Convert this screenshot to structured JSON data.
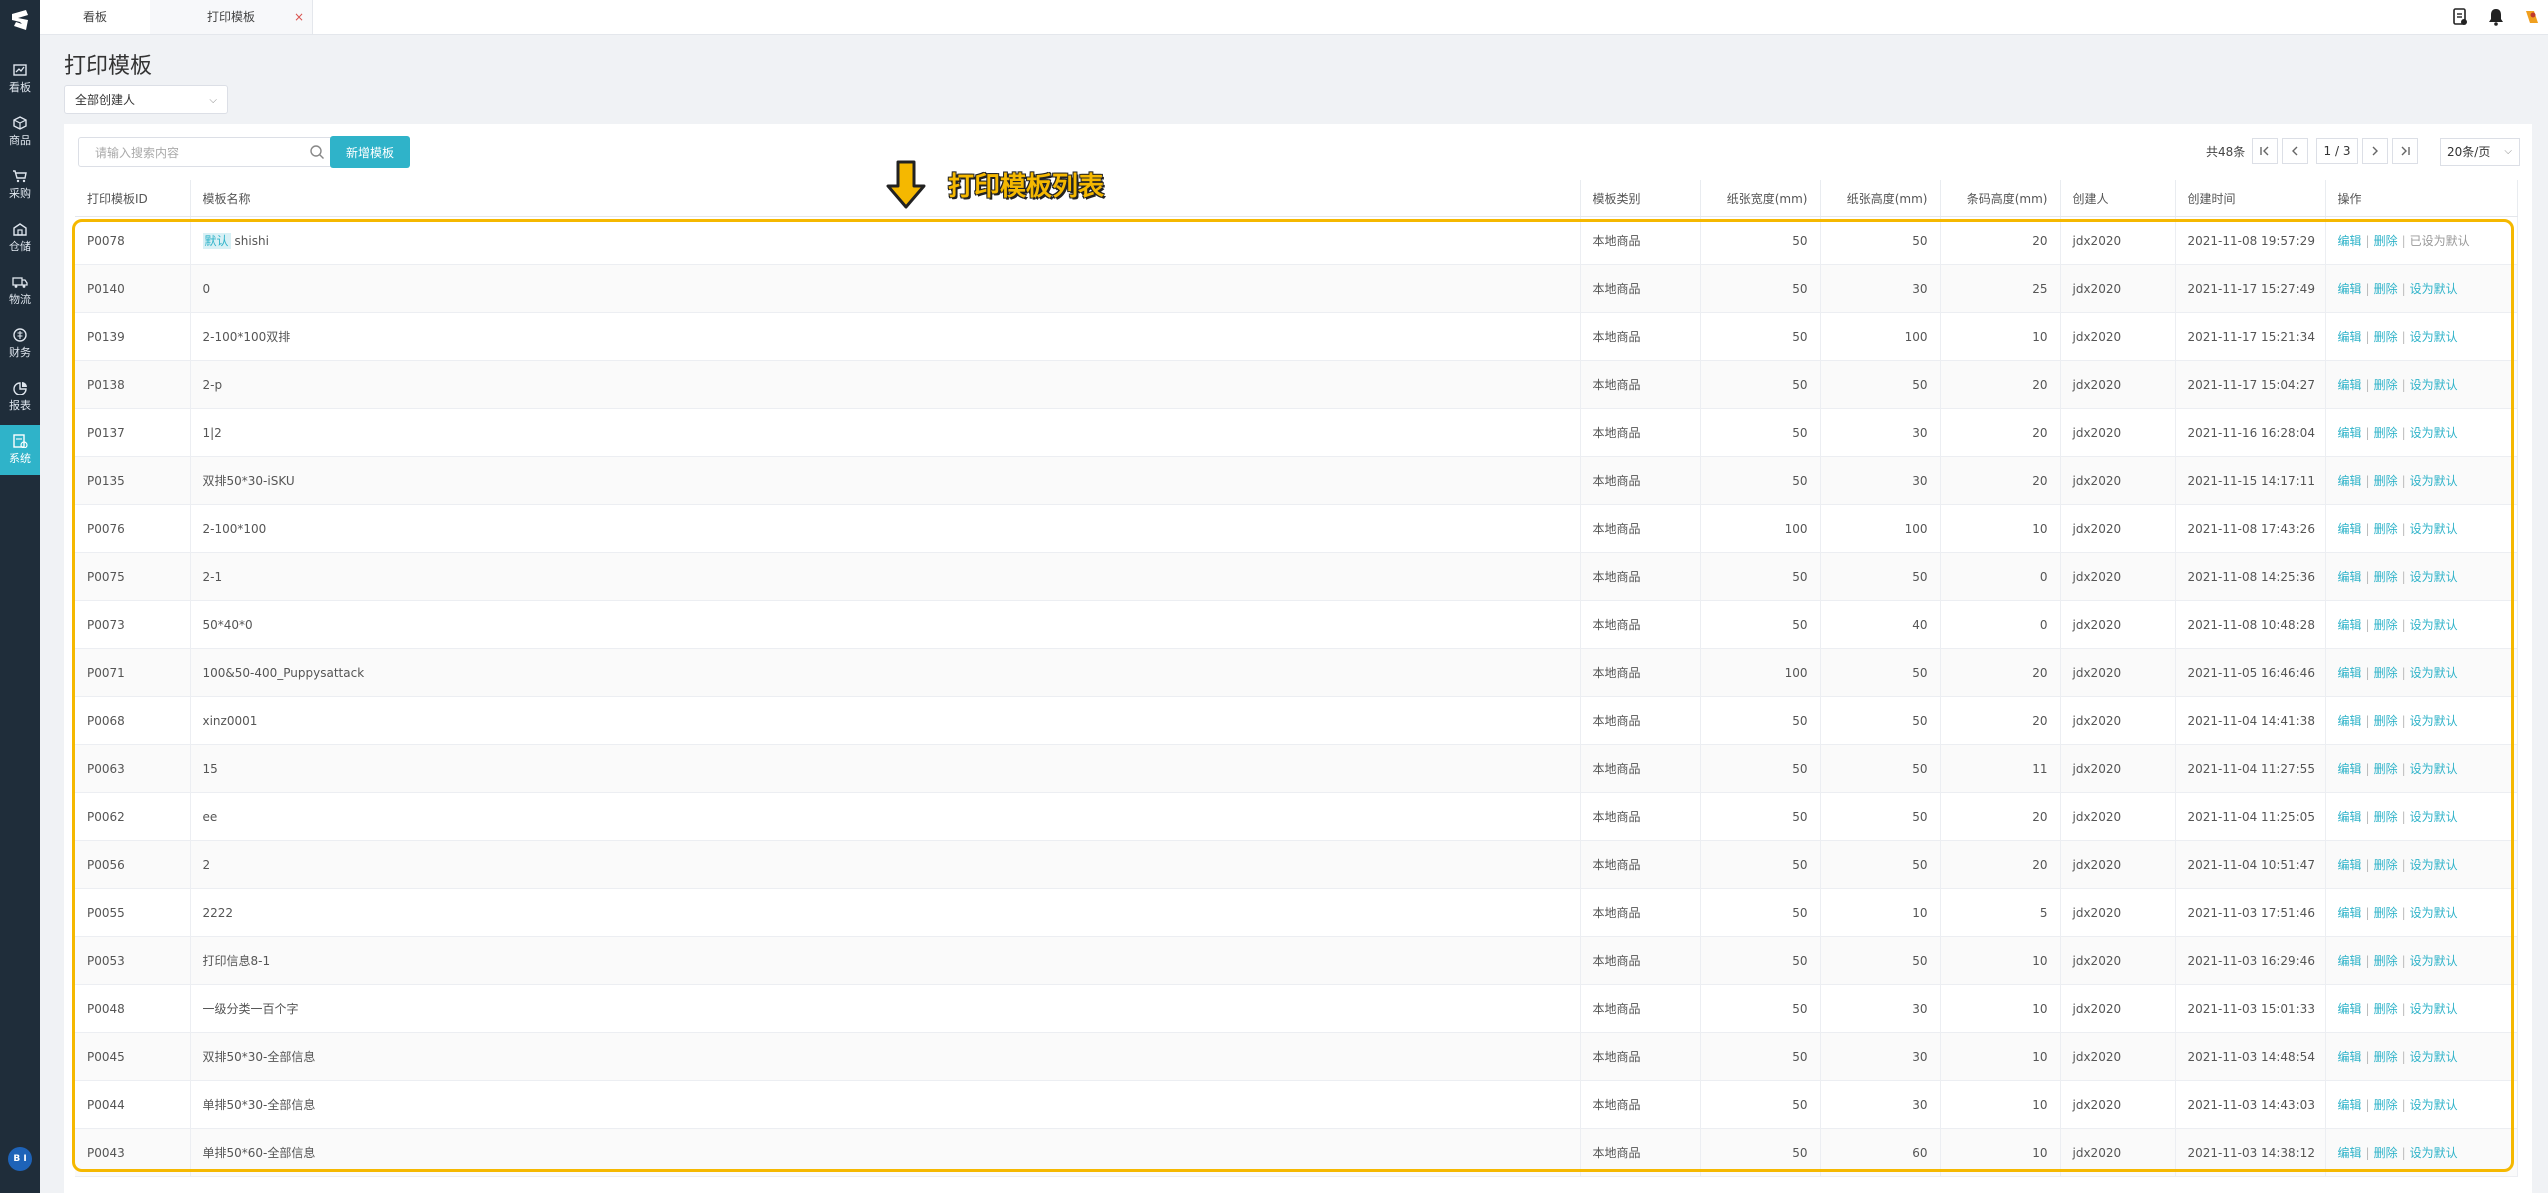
{
  "sidebar": {
    "items": [
      {
        "label": "看板",
        "icon": "chart-icon"
      },
      {
        "label": "商品",
        "icon": "cube-icon"
      },
      {
        "label": "采购",
        "icon": "cart-icon"
      },
      {
        "label": "仓储",
        "icon": "warehouse-icon"
      },
      {
        "label": "物流",
        "icon": "truck-icon"
      },
      {
        "label": "财务",
        "icon": "finance-icon"
      },
      {
        "label": "报表",
        "icon": "pie-icon"
      },
      {
        "label": "系统",
        "icon": "system-icon"
      }
    ],
    "active": "系统",
    "avatar": "B I"
  },
  "tabs": [
    {
      "label": "看板"
    },
    {
      "label": "打印模板",
      "close": "×"
    }
  ],
  "page": {
    "title": "打印模板",
    "creator_filter": "全部创建人",
    "search_placeholder": "请输入搜索内容",
    "add_button": "新增模板"
  },
  "pagination": {
    "total": "共48条",
    "current": "1",
    "pages": "/ 3",
    "page_size": "20条/页"
  },
  "annotation": {
    "label": "打印模板列表",
    "color": "#f5b800"
  },
  "table": {
    "columns": [
      "打印模板ID",
      "模板名称",
      "模板类别",
      "纸张宽度(mm)",
      "纸张高度(mm)",
      "条码高度(mm)",
      "创建人",
      "创建时间",
      "操作"
    ],
    "ops": {
      "edit": "编辑",
      "delete": "删除",
      "set_default": "设为默认",
      "is_default": "已设为默认",
      "sep": "|"
    },
    "default_tag": "默认",
    "rows": [
      {
        "id": "P0078",
        "name": "shishi",
        "is_default": true,
        "category": "本地商品",
        "width": "50",
        "height": "50",
        "barcode": "20",
        "creator": "jdx2020",
        "created": "2021-11-08 19:57:29"
      },
      {
        "id": "P0140",
        "name": "0",
        "category": "本地商品",
        "width": "50",
        "height": "30",
        "barcode": "25",
        "creator": "jdx2020",
        "created": "2021-11-17 15:27:49"
      },
      {
        "id": "P0139",
        "name": "2-100*100双排",
        "category": "本地商品",
        "width": "50",
        "height": "100",
        "barcode": "10",
        "creator": "jdx2020",
        "created": "2021-11-17 15:21:34"
      },
      {
        "id": "P0138",
        "name": "2-p",
        "category": "本地商品",
        "width": "50",
        "height": "50",
        "barcode": "20",
        "creator": "jdx2020",
        "created": "2021-11-17 15:04:27"
      },
      {
        "id": "P0137",
        "name": "1|2",
        "category": "本地商品",
        "width": "50",
        "height": "30",
        "barcode": "20",
        "creator": "jdx2020",
        "created": "2021-11-16 16:28:04"
      },
      {
        "id": "P0135",
        "name": "双排50*30-iSKU",
        "category": "本地商品",
        "width": "50",
        "height": "30",
        "barcode": "20",
        "creator": "jdx2020",
        "created": "2021-11-15 14:17:11"
      },
      {
        "id": "P0076",
        "name": "2-100*100",
        "category": "本地商品",
        "width": "100",
        "height": "100",
        "barcode": "10",
        "creator": "jdx2020",
        "created": "2021-11-08 17:43:26"
      },
      {
        "id": "P0075",
        "name": "2-1",
        "category": "本地商品",
        "width": "50",
        "height": "50",
        "barcode": "0",
        "creator": "jdx2020",
        "created": "2021-11-08 14:25:36"
      },
      {
        "id": "P0073",
        "name": "50*40*0",
        "category": "本地商品",
        "width": "50",
        "height": "40",
        "barcode": "0",
        "creator": "jdx2020",
        "created": "2021-11-08 10:48:28"
      },
      {
        "id": "P0071",
        "name": "100&50-400_Puppysattack",
        "category": "本地商品",
        "width": "100",
        "height": "50",
        "barcode": "20",
        "creator": "jdx2020",
        "created": "2021-11-05 16:46:46"
      },
      {
        "id": "P0068",
        "name": "xinz0001",
        "category": "本地商品",
        "width": "50",
        "height": "50",
        "barcode": "20",
        "creator": "jdx2020",
        "created": "2021-11-04 14:41:38"
      },
      {
        "id": "P0063",
        "name": "15",
        "category": "本地商品",
        "width": "50",
        "height": "50",
        "barcode": "11",
        "creator": "jdx2020",
        "created": "2021-11-04 11:27:55"
      },
      {
        "id": "P0062",
        "name": "ee",
        "category": "本地商品",
        "width": "50",
        "height": "50",
        "barcode": "20",
        "creator": "jdx2020",
        "created": "2021-11-04 11:25:05"
      },
      {
        "id": "P0056",
        "name": "2",
        "category": "本地商品",
        "width": "50",
        "height": "50",
        "barcode": "20",
        "creator": "jdx2020",
        "created": "2021-11-04 10:51:47"
      },
      {
        "id": "P0055",
        "name": "2222",
        "category": "本地商品",
        "width": "50",
        "height": "10",
        "barcode": "5",
        "creator": "jdx2020",
        "created": "2021-11-03 17:51:46"
      },
      {
        "id": "P0053",
        "name": "打印信息8-1",
        "category": "本地商品",
        "width": "50",
        "height": "50",
        "barcode": "10",
        "creator": "jdx2020",
        "created": "2021-11-03 16:29:46"
      },
      {
        "id": "P0048",
        "name": "一级分类一百个字",
        "category": "本地商品",
        "width": "50",
        "height": "30",
        "barcode": "10",
        "creator": "jdx2020",
        "created": "2021-11-03 15:01:33"
      },
      {
        "id": "P0045",
        "name": "双排50*30-全部信息",
        "category": "本地商品",
        "width": "50",
        "height": "30",
        "barcode": "10",
        "creator": "jdx2020",
        "created": "2021-11-03 14:48:54"
      },
      {
        "id": "P0044",
        "name": "单排50*30-全部信息",
        "category": "本地商品",
        "width": "50",
        "height": "30",
        "barcode": "10",
        "creator": "jdx2020",
        "created": "2021-11-03 14:43:03"
      },
      {
        "id": "P0043",
        "name": "单排50*60-全部信息",
        "category": "本地商品",
        "width": "50",
        "height": "60",
        "barcode": "10",
        "creator": "jdx2020",
        "created": "2021-11-03 14:38:12"
      }
    ]
  }
}
